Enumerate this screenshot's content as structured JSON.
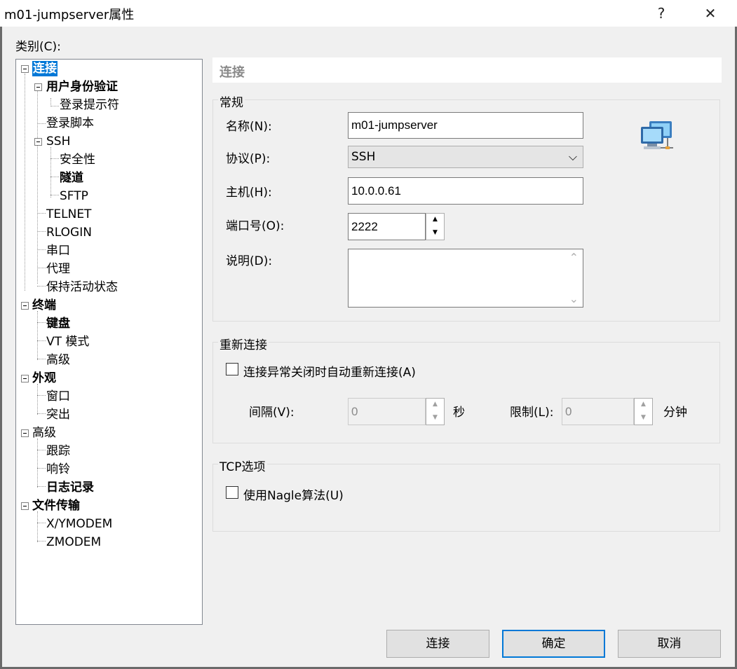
{
  "window": {
    "title": "m01-jumpserver属性",
    "help_glyph": "?",
    "close_glyph": "✕"
  },
  "category_label": "类别(C):",
  "tree": {
    "connection": "连接",
    "user_auth": "用户身份验证",
    "login_prompt": "登录提示符",
    "login_script": "登录脚本",
    "ssh": "SSH",
    "security": "安全性",
    "tunnel": "隧道",
    "sftp": "SFTP",
    "telnet": "TELNET",
    "rlogin": "RLOGIN",
    "serial": "串口",
    "proxy": "代理",
    "keepalive": "保持活动状态",
    "terminal": "终端",
    "keyboard": "键盘",
    "vt_mode": "VT 模式",
    "term_advanced": "高级",
    "appearance": "外观",
    "window": "窗口",
    "highlight": "突出",
    "advanced": "高级",
    "trace": "跟踪",
    "bell": "响铃",
    "logging": "日志记录",
    "file_transfer": "文件传输",
    "xymodem": "X/YMODEM",
    "zmodem": "ZMODEM"
  },
  "panel": {
    "header": "连接",
    "general": {
      "title": "常规",
      "name_label": "名称(N):",
      "name_value": "m01-jumpserver",
      "protocol_label": "协议(P):",
      "protocol_value": "SSH",
      "host_label": "主机(H):",
      "host_value": "10.0.0.61",
      "port_label": "端口号(O):",
      "port_value": "2222",
      "desc_label": "说明(D):",
      "desc_value": ""
    },
    "reconnect": {
      "title": "重新连接",
      "checkbox_label": "连接异常关闭时自动重新连接(A)",
      "checked": false,
      "interval_label": "间隔(V):",
      "interval_value": "0",
      "interval_unit": "秒",
      "limit_label": "限制(L):",
      "limit_value": "0",
      "limit_unit": "分钟"
    },
    "tcp": {
      "title": "TCP选项",
      "nagle_label": "使用Nagle算法(U)",
      "checked": false
    }
  },
  "buttons": {
    "connect": "连接",
    "ok": "确定",
    "cancel": "取消"
  },
  "colors": {
    "selection": "#0078d7",
    "default_button_border": "#0078d7"
  },
  "icons": {
    "session": "network-computers-icon",
    "spin_up": "▲",
    "spin_down": "▼",
    "select_arrow": "⌵",
    "scroll_up": "⌃",
    "scroll_down": "⌄"
  }
}
